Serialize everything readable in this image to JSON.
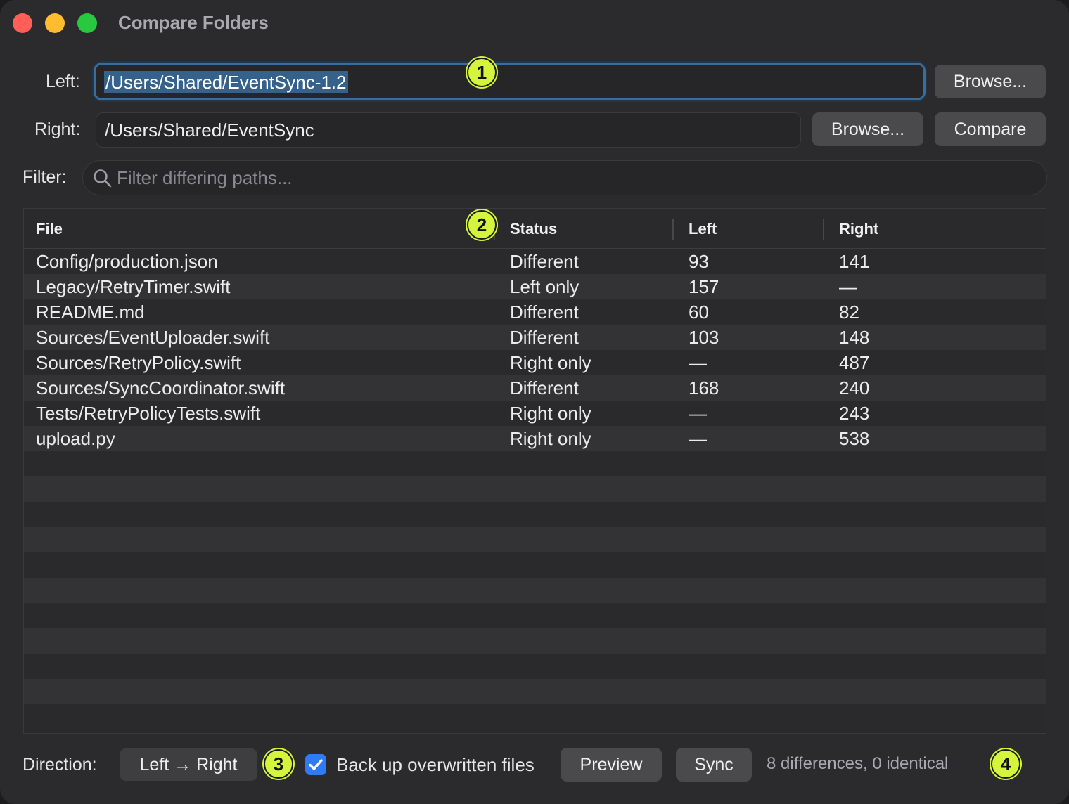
{
  "window": {
    "title": "Compare Folders"
  },
  "left": {
    "label": "Left:",
    "path": "/Users/Shared/EventSync-1.2",
    "browse": "Browse..."
  },
  "right": {
    "label": "Right:",
    "path": "/Users/Shared/EventSync",
    "browse": "Browse...",
    "compare": "Compare"
  },
  "filter": {
    "label": "Filter:",
    "placeholder": "Filter differing paths..."
  },
  "table": {
    "columns": [
      "File",
      "Status",
      "Left",
      "Right"
    ],
    "rows": [
      {
        "file": "Config/production.json",
        "status": "Different",
        "left": "93",
        "right": "141"
      },
      {
        "file": "Legacy/RetryTimer.swift",
        "status": "Left only",
        "left": "157",
        "right": "—"
      },
      {
        "file": "README.md",
        "status": "Different",
        "left": "60",
        "right": "82"
      },
      {
        "file": "Sources/EventUploader.swift",
        "status": "Different",
        "left": "103",
        "right": "148"
      },
      {
        "file": "Sources/RetryPolicy.swift",
        "status": "Right only",
        "left": "—",
        "right": "487"
      },
      {
        "file": "Sources/SyncCoordinator.swift",
        "status": "Different",
        "left": "168",
        "right": "240"
      },
      {
        "file": "Tests/RetryPolicyTests.swift",
        "status": "Right only",
        "left": "—",
        "right": "243"
      },
      {
        "file": "upload.py",
        "status": "Right only",
        "left": "—",
        "right": "538"
      }
    ]
  },
  "bottom": {
    "direction_label": "Direction:",
    "direction_value": "Left → Right",
    "backup_label": "Back up overwritten files",
    "backup_checked": true,
    "preview": "Preview",
    "sync": "Sync",
    "status": "8 differences, 0 identical"
  },
  "badges": [
    "1",
    "2",
    "3",
    "4"
  ],
  "colors": {
    "accent": "#2f7bf5",
    "badge": "#d4f53c",
    "selection": "#35628c"
  }
}
